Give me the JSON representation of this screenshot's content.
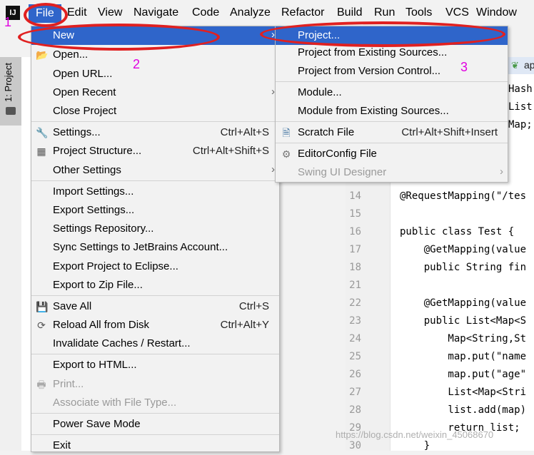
{
  "menubar": {
    "logo": "IJ",
    "items": [
      "File",
      "Edit",
      "View",
      "Navigate",
      "Code",
      "Analyze",
      "Refactor",
      "Build",
      "Run",
      "Tools",
      "VCS",
      "Window"
    ]
  },
  "sidebar": {
    "project_tab": "1: Project"
  },
  "annotations": {
    "n1": "1",
    "n2": "2",
    "n3": "3",
    "color": "#e02020"
  },
  "file_menu": {
    "new": "New",
    "open": "Open...",
    "open_url": "Open URL...",
    "open_recent": "Open Recent",
    "close_project": "Close Project",
    "settings": "Settings...",
    "settings_sc": "Ctrl+Alt+S",
    "project_structure": "Project Structure...",
    "project_structure_sc": "Ctrl+Alt+Shift+S",
    "other_settings": "Other Settings",
    "import_settings": "Import Settings...",
    "export_settings": "Export Settings...",
    "settings_repository": "Settings Repository...",
    "sync_settings": "Sync Settings to JetBrains Account...",
    "export_eclipse": "Export Project to Eclipse...",
    "export_zip": "Export to Zip File...",
    "save_all": "Save All",
    "save_all_sc": "Ctrl+S",
    "reload_all": "Reload All from Disk",
    "reload_all_sc": "Ctrl+Alt+Y",
    "invalidate": "Invalidate Caches / Restart...",
    "export_html": "Export to HTML...",
    "print": "Print...",
    "associate": "Associate with File Type...",
    "power_save": "Power Save Mode",
    "exit": "Exit"
  },
  "new_submenu": {
    "project": "Project...",
    "project_existing": "Project from Existing Sources...",
    "project_vcs": "Project from Version Control...",
    "module": "Module...",
    "module_existing": "Module from Existing Sources...",
    "scratch": "Scratch File",
    "scratch_sc": "Ctrl+Alt+Shift+Insert",
    "editorconfig": "EditorConfig File",
    "swing": "Swing UI Designer"
  },
  "editor": {
    "tab": "ap",
    "lines": [
      {
        "n": "14",
        "text": "@RequestMapping(\"/tes"
      },
      {
        "n": "15",
        "text": ""
      },
      {
        "n": "16",
        "text": "public class Test {"
      },
      {
        "n": "17",
        "text": "    @GetMapping(value"
      },
      {
        "n": "18",
        "text": "    public String fin"
      },
      {
        "n": "21",
        "text": ""
      },
      {
        "n": "22",
        "text": "    @GetMapping(value"
      },
      {
        "n": "23",
        "text": "    public List<Map<S"
      },
      {
        "n": "24",
        "text": "        Map<String,St"
      },
      {
        "n": "25",
        "text": "        map.put(\"name"
      },
      {
        "n": "26",
        "text": "        map.put(\"age\""
      },
      {
        "n": "27",
        "text": "        List<Map<Stri"
      },
      {
        "n": "28",
        "text": "        list.add(map)"
      },
      {
        "n": "29",
        "text": "        return list;"
      },
      {
        "n": "30",
        "text": "    }"
      }
    ],
    "top_lines": [
      "Hash",
      "List",
      "Map;"
    ]
  },
  "watermark": "https://blog.csdn.net/weixin_45068670"
}
